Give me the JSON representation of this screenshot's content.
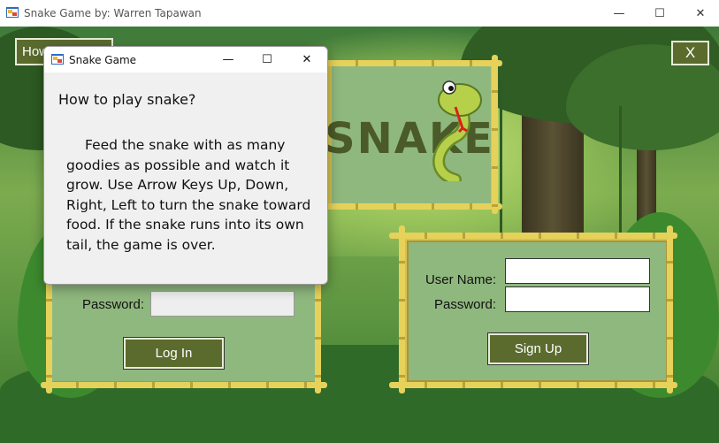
{
  "window": {
    "title": "Snake Game by: Warren Tapawan",
    "minimize": "—",
    "maximize": "☐",
    "close": "✕"
  },
  "top_left_button": {
    "label": "How"
  },
  "top_right_button": {
    "label": "X"
  },
  "logo": {
    "text": "SNAKE"
  },
  "login_panel": {
    "password_label": "Password:",
    "password_value": "",
    "login_button": "Log In"
  },
  "signup_panel": {
    "username_label": "User Name:",
    "username_value": "",
    "password_label": "Password:",
    "password_value": "",
    "signup_button": "Sign Up"
  },
  "dialog": {
    "title": "Snake Game",
    "minimize": "—",
    "maximize": "☐",
    "close": "✕",
    "heading": "How to play snake?",
    "body": "Feed the snake with as many goodies as possible and watch it grow. Use Arrow Keys Up, Down, Right, Left to turn the snake toward food. If the snake runs into its own tail, the game is over."
  },
  "colors": {
    "button_bg": "#5b6b2e",
    "panel_bg": "#8fb87e",
    "bamboo": "#d8c24e",
    "dialog_bg": "#f0f0f0"
  }
}
